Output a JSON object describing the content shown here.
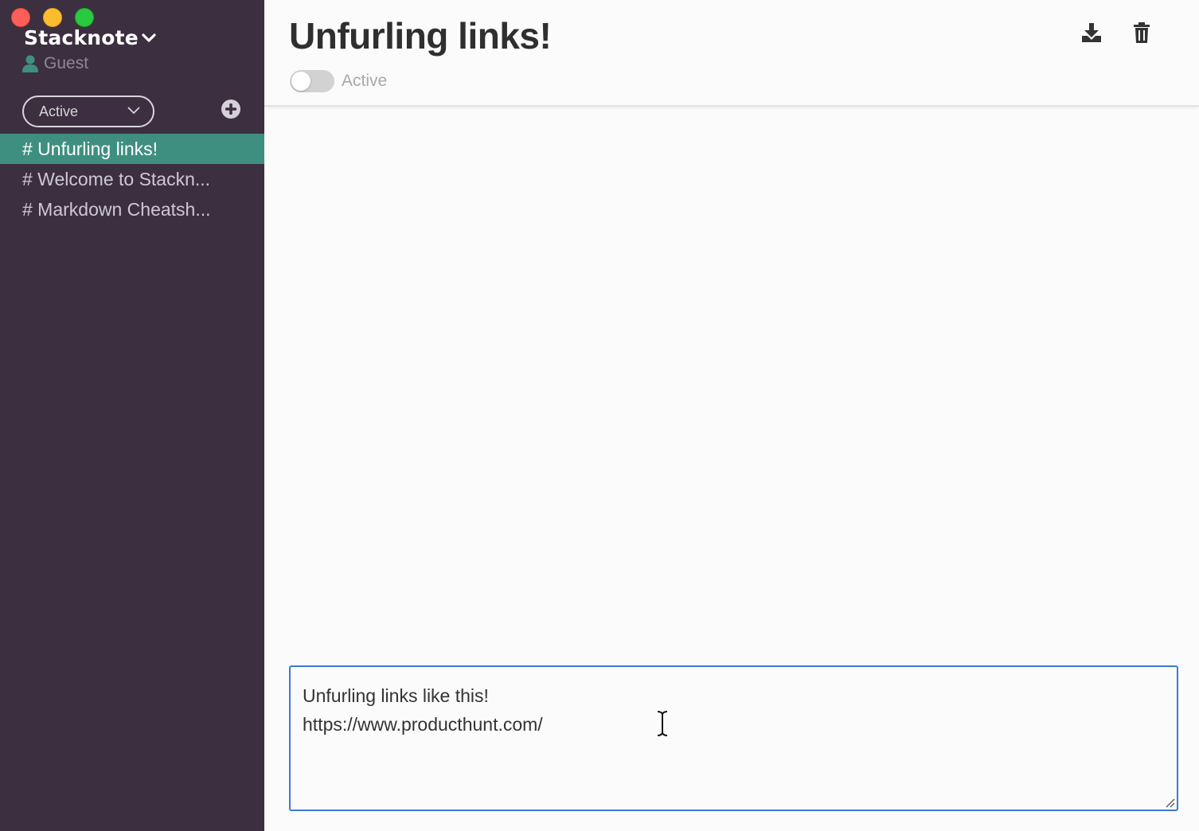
{
  "app": {
    "name": "Stacknote",
    "user": "Guest",
    "window_controls": [
      "close",
      "minimize",
      "maximize"
    ]
  },
  "sidebar": {
    "filter": {
      "selected": "Active"
    },
    "add_icon": "plus-circle-icon",
    "notes": [
      {
        "label": "# Unfurling links!",
        "active": true
      },
      {
        "label": "# Welcome to Stackn...",
        "active": false
      },
      {
        "label": "# Markdown Cheatsh...",
        "active": false
      }
    ]
  },
  "note": {
    "title": "Unfurling links!",
    "status_label": "Active",
    "status_on": false,
    "actions": [
      "download-icon",
      "trash-icon"
    ]
  },
  "editor": {
    "line1": "Unfurling links like this!",
    "line2": "https://www.producthunt.com/"
  },
  "colors": {
    "sidebar_bg": "#3c3040",
    "active_note": "#3f8f80",
    "editor_border": "#3d78d8"
  }
}
